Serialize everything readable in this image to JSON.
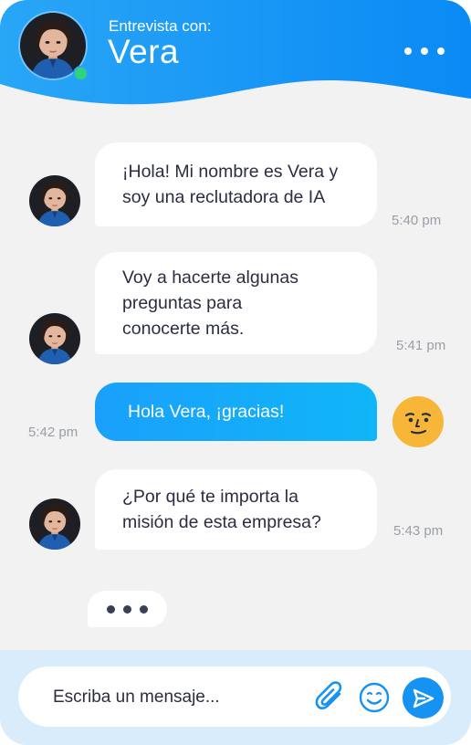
{
  "header": {
    "subtitle": "Entrevista con:",
    "name": "Vera",
    "more_icon": "more-horizontal-icon",
    "status": "online"
  },
  "messages": [
    {
      "sender": "recruiter",
      "text": "¡Hola! Mi nombre es Vera y\nsoy una reclutadora de IA",
      "time": "5:40 pm"
    },
    {
      "sender": "recruiter",
      "text": "Voy a hacerte algunas\npreguntas para\nconocerte más.",
      "time": "5:41 pm"
    },
    {
      "sender": "user",
      "text": "Hola Vera, ¡gracias!",
      "time": "5:42 pm"
    },
    {
      "sender": "recruiter",
      "text": "¿Por qué te importa la\nmisión de esta empresa?",
      "time": "5:43 pm"
    }
  ],
  "typing_indicator": true,
  "composer": {
    "placeholder": "Escriba un mensaje...",
    "attach_icon": "paperclip-icon",
    "emoji_icon": "smiley-icon",
    "send_icon": "send-icon"
  },
  "colors": {
    "header_gradient_start": "#29a3f5",
    "header_gradient_end": "#0b8cf5",
    "user_bubble": "#1aa0fb",
    "background": "#f2f2f2",
    "composer_bar": "#d8ecfb",
    "send_button": "#1592f2",
    "user_avatar": "#f7b637",
    "online": "#2fd37a"
  }
}
